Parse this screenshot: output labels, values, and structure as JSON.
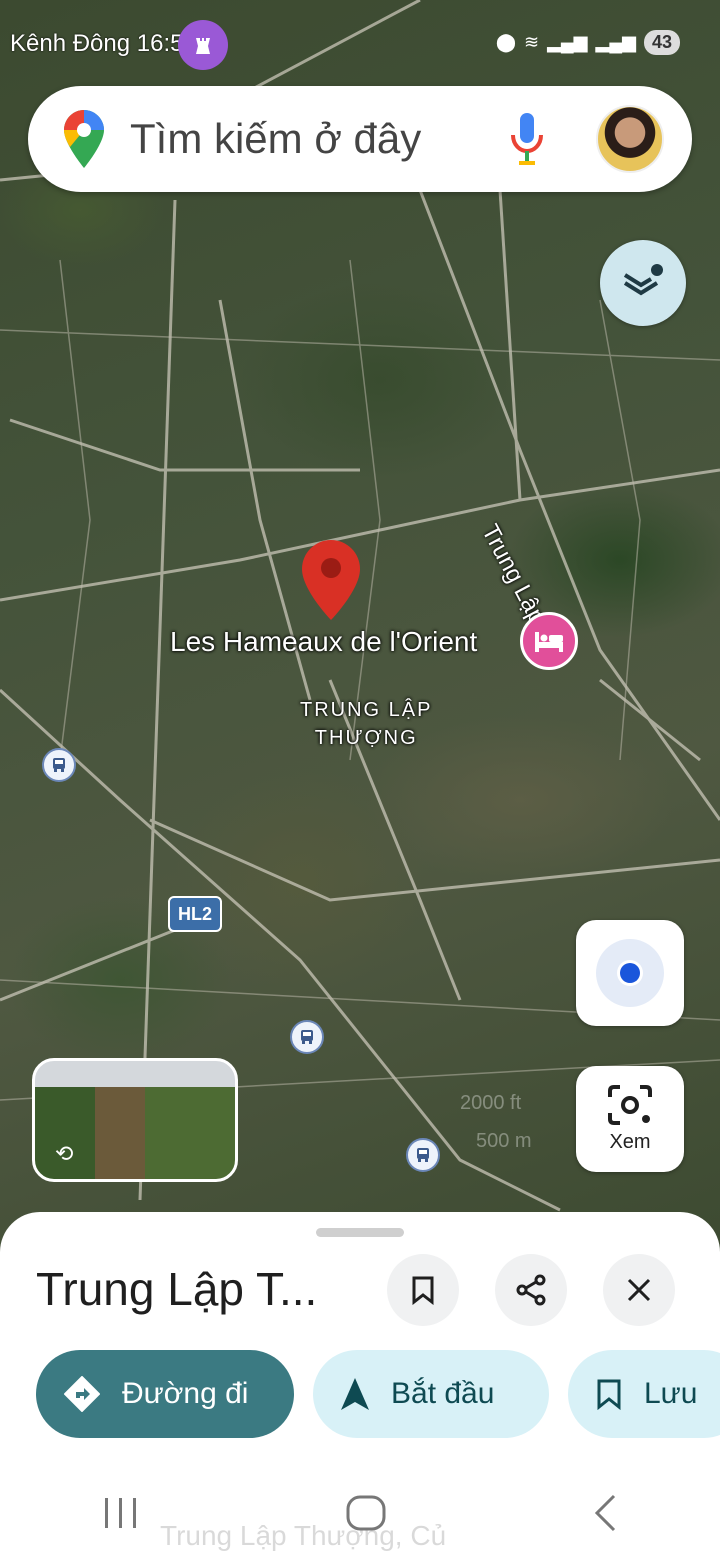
{
  "status_bar": {
    "left_text": "Kênh Đông 16:52",
    "battery": "43"
  },
  "search": {
    "placeholder": "Tìm kiếm ở đây"
  },
  "map": {
    "place_name": "Les Hameaux de l'Orient",
    "area_line1": "TRUNG LẬP",
    "area_line2": "THƯỢNG",
    "road_name": "Trung Lập",
    "route_shield": "HL2",
    "scale_ft": "2000 ft",
    "scale_m": "500 m"
  },
  "buttons": {
    "xem_label": "Xem"
  },
  "sheet": {
    "title": "Trung Lập T...",
    "directions_label": "Đường đi",
    "start_label": "Bắt đầu",
    "save_label": "Lưu",
    "address_ghost": "Trung Lập Thượng, Củ"
  },
  "colors": {
    "primary_pill": "#3b7a82",
    "secondary_pill": "#d8f1f7",
    "pin_red": "#d93025",
    "hotel_pink": "#e14f9a"
  }
}
